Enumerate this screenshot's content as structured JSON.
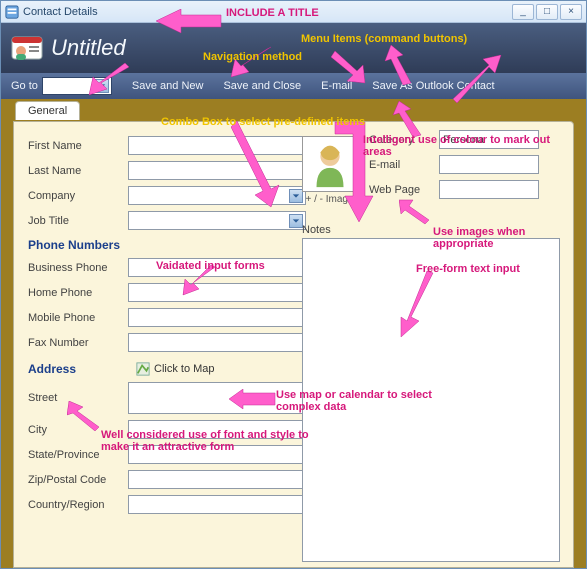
{
  "window": {
    "title": "Contact Details"
  },
  "header": {
    "title": "Untitled"
  },
  "cmdbar": {
    "gotoLabel": "Go to",
    "saveNew": "Save and New",
    "saveClose": "Save and Close",
    "email": "E-mail",
    "saveOutlook": "Save As Outlook Contact"
  },
  "tabs": {
    "general": "General"
  },
  "fields": {
    "firstName": "First Name",
    "lastName": "Last Name",
    "company": "Company",
    "jobTitle": "Job Title",
    "category": "Category",
    "categoryValue": "Persona",
    "emailLabel": "E-mail",
    "webPage": "Web Page",
    "section_phones": "Phone Numbers",
    "businessPhone": "Business Phone",
    "homePhone": "Home Phone",
    "mobilePhone": "Mobile Phone",
    "faxNumber": "Fax Number",
    "section_address": "Address",
    "clickToMap": "Click to Map",
    "street": "Street",
    "city": "City",
    "state": "State/Province",
    "zip": "Zip/Postal Code",
    "country": "Country/Region",
    "notes": "Notes",
    "avatarCaption": "+ / - Images"
  },
  "annotations": {
    "includeTitle": "INCLUDE A TITLE",
    "menuItems": "Menu Items (command buttons)",
    "navMethod": "Navigation method",
    "comboPredef": "Combo Box to select pre-defined items",
    "colourMark": "Intelligent use of colour to mark out areas",
    "useImages": "Use images when appropriate",
    "validated": "Vaidated input forms",
    "freeform": "Free-form text input",
    "mapCalendar": "Use map or calendar to select complex data",
    "fontStyle": "Well considered use of font and style to make it an attractive form"
  }
}
